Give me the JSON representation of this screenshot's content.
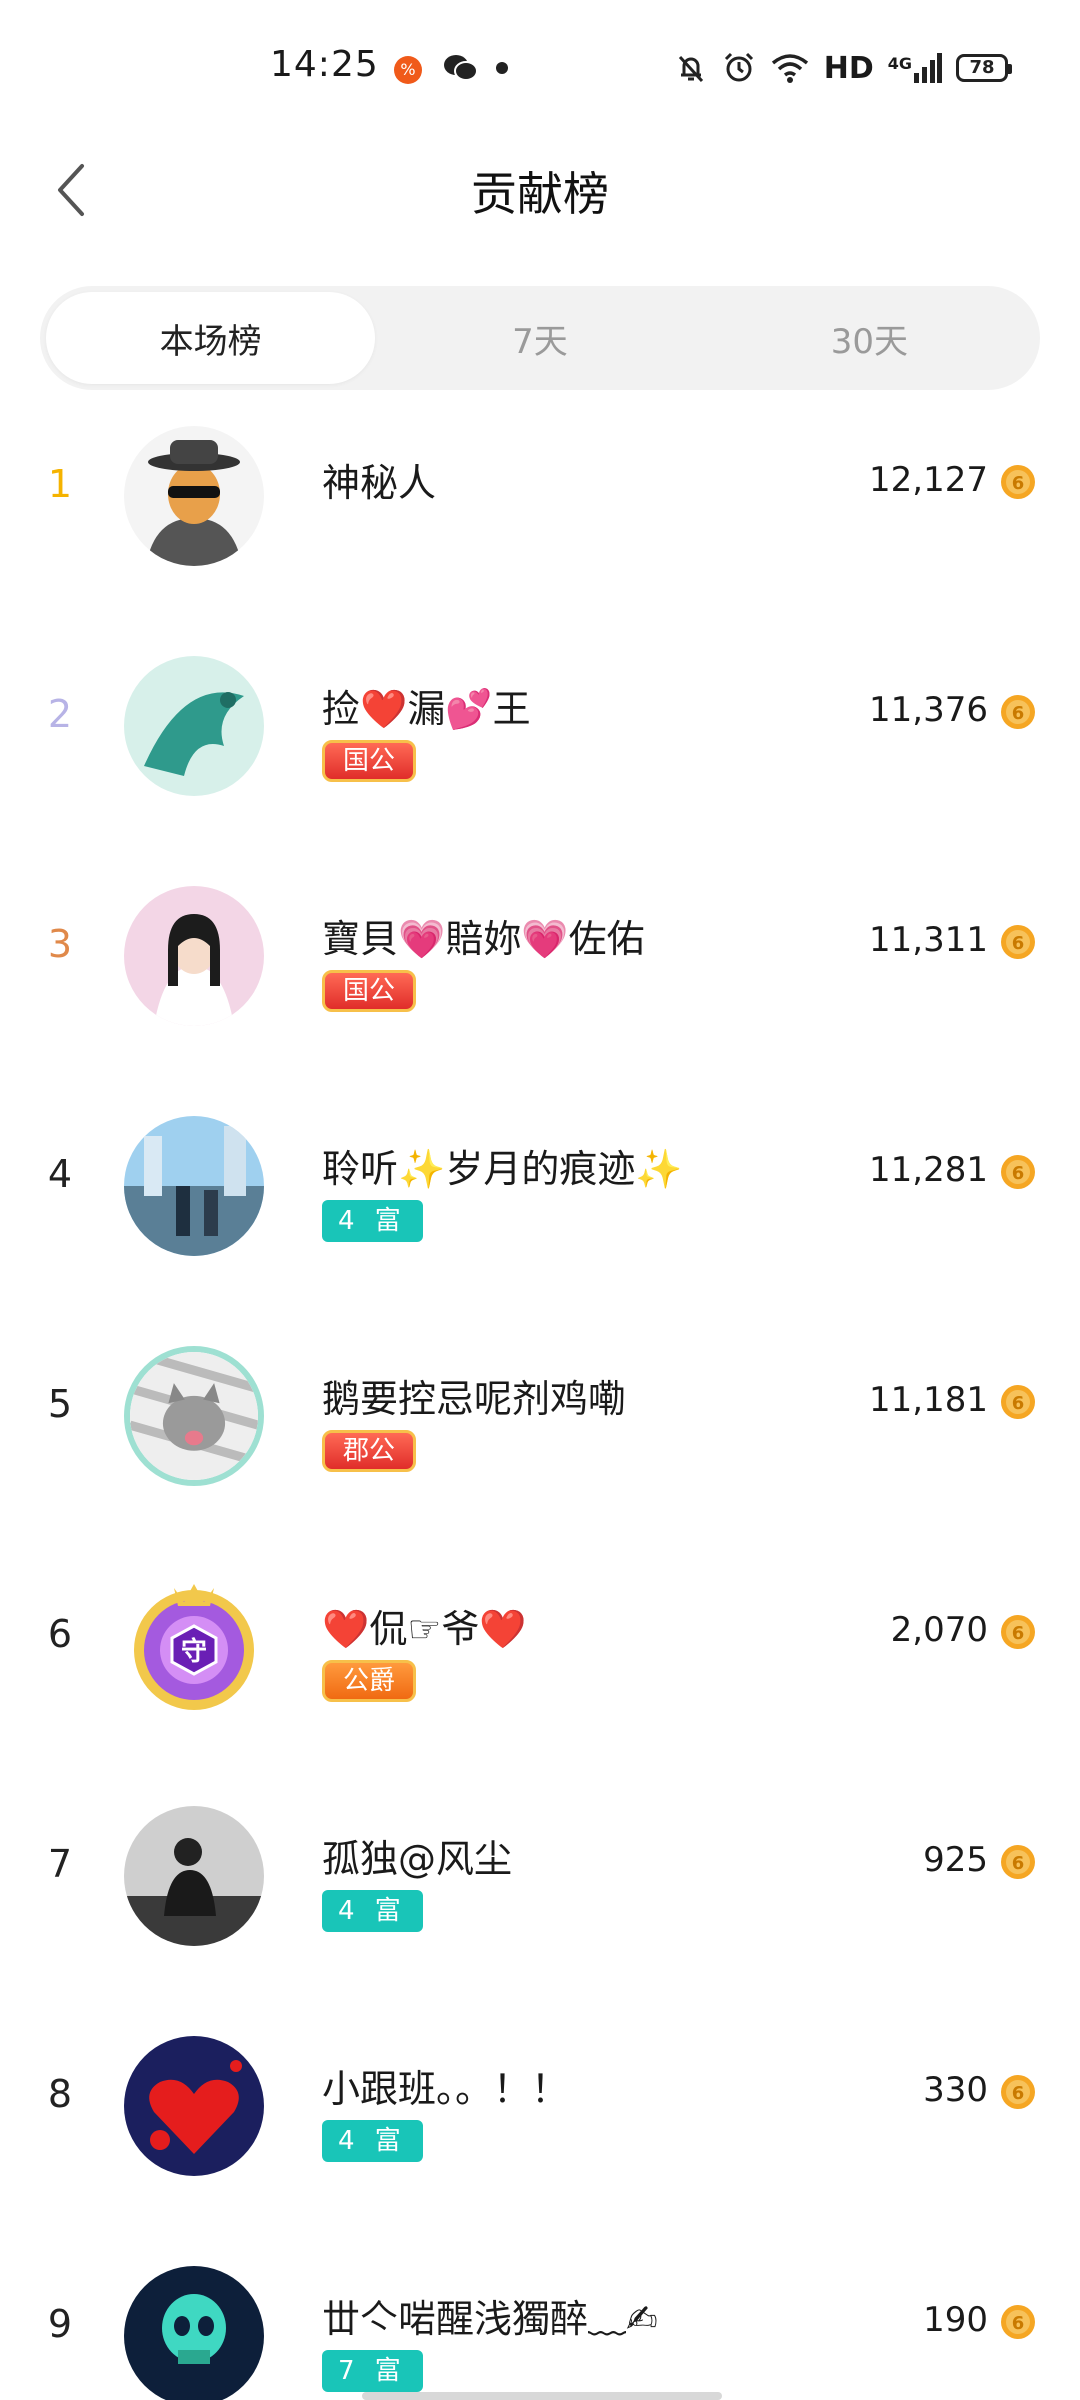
{
  "status_bar": {
    "time": "14:25",
    "hd": "HD",
    "network": "4G",
    "battery": "78",
    "icons": [
      "app-notification-icon",
      "wechat-icon",
      "mute-bell-icon",
      "alarm-icon",
      "wifi-icon",
      "signal-icon",
      "battery-icon"
    ]
  },
  "header": {
    "title": "贡献榜",
    "back_icon": "chevron-left-icon"
  },
  "tabs": [
    {
      "label": "本场榜",
      "active": true
    },
    {
      "label": "7天",
      "active": false
    },
    {
      "label": "30天",
      "active": false
    }
  ],
  "ranking": [
    {
      "rank": "1",
      "name": "神秘人",
      "badge": "",
      "score": "12,127"
    },
    {
      "rank": "2",
      "name": "捡❤️漏💕王",
      "badge": "国公",
      "score": "11,376"
    },
    {
      "rank": "3",
      "name": "寶貝💗賠妳💗佐佑",
      "badge": "国公",
      "score": "11,311"
    },
    {
      "rank": "4",
      "name": "聆听✨岁月的痕迹✨",
      "badge": "4 富",
      "score": "11,281"
    },
    {
      "rank": "5",
      "name": "鹅要控忌呢剂鸡嘞",
      "badge": "郡公",
      "score": "11,181"
    },
    {
      "rank": "6",
      "name": "❤️侃☞爷❤️",
      "badge": "公爵",
      "score": "2,070"
    },
    {
      "rank": "7",
      "name": "孤独@风尘",
      "badge": "4 富",
      "score": "925"
    },
    {
      "rank": "8",
      "name": "小跟班。。！！",
      "badge": "4 富",
      "score": "330"
    },
    {
      "rank": "9",
      "name": "丗亽啱醒浅獨醉﹏✍",
      "badge": "7 富",
      "score": "190"
    }
  ],
  "colors": {
    "rank1": "#f5b300",
    "rank2": "#b7b3e6",
    "rank3": "#e0894a",
    "fu_badge": "#19c5b8",
    "gong_badge": "#e02d2a",
    "coin": "#f5a623"
  }
}
